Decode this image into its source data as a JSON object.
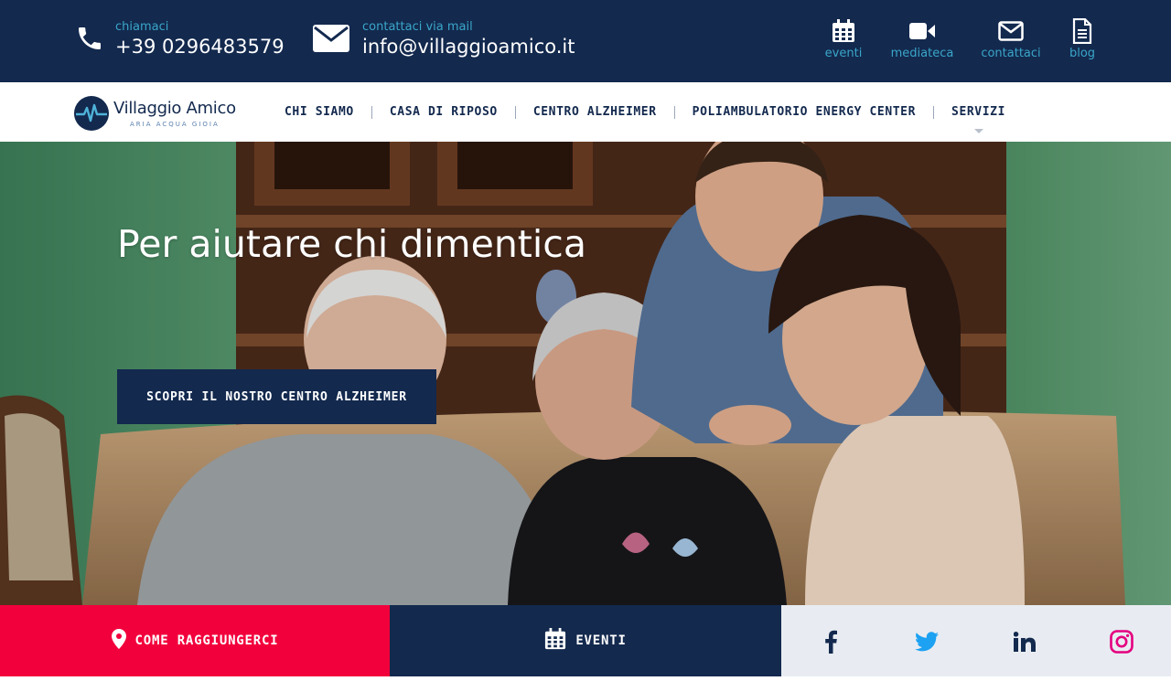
{
  "topbar": {
    "phone": {
      "label": "chiamaci",
      "value": "+39 0296483579",
      "icon": "phone-icon"
    },
    "mail": {
      "label": "contattaci via mail",
      "value": "info@villaggioamico.it",
      "icon": "envelope-icon"
    },
    "quick_links": [
      {
        "label": "eventi",
        "icon": "calendar-icon"
      },
      {
        "label": "mediateca",
        "icon": "video-camera-icon"
      },
      {
        "label": "contattaci",
        "icon": "envelope-outline-icon"
      },
      {
        "label": "blog",
        "icon": "document-icon"
      }
    ]
  },
  "nav": {
    "logo": {
      "name": "Villaggio Amico",
      "tagline": "ARIA ACQUA GIOIA"
    },
    "items": [
      "CHI SIAMO",
      "CASA DI RIPOSO",
      "CENTRO ALZHEIMER",
      "POLIAMBULATORIO ENERGY CENTER",
      "SERVIZI"
    ]
  },
  "hero": {
    "title": "Per aiutare chi dimentica",
    "cta": "SCOPRI IL NOSTRO CENTRO ALZHEIMER"
  },
  "bottom": {
    "route_label": "COME RAGGIUNGERCI",
    "events_label": "EVENTI",
    "social": [
      "facebook",
      "twitter",
      "linkedin",
      "instagram"
    ]
  },
  "colors": {
    "navy": "#13294e",
    "accent_teal": "#3aa6c9",
    "accent_red": "#f2003c",
    "social_bg": "#e8ecf2"
  }
}
